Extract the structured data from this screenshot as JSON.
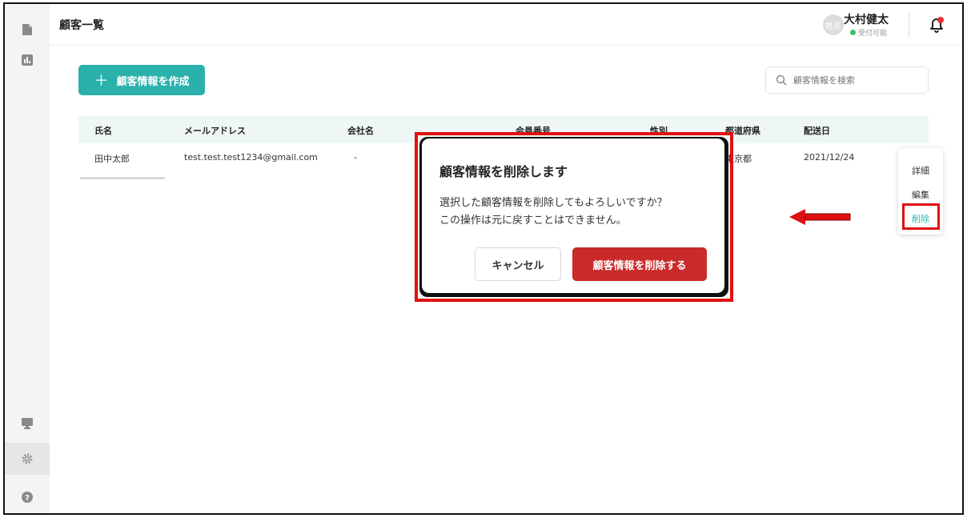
{
  "header": {
    "title": "顧客一覧",
    "avatar_text": "姓名",
    "user_name": "大村健太",
    "user_status": "受付可能"
  },
  "toolbar": {
    "create_label": "顧客情報を作成",
    "create_plus": "＋",
    "search_placeholder": "顧客情報を検索"
  },
  "table": {
    "columns": [
      "氏名",
      "メールアドレス",
      "会社名",
      "会員番号",
      "性別",
      "都道府県",
      "配送日"
    ],
    "rows": [
      [
        "田中太郎",
        "test.test.test1234@gmail.com",
        "-",
        "",
        "",
        "東京都",
        "2021/12/24"
      ]
    ]
  },
  "row_menu": {
    "items": [
      "詳細",
      "編集",
      "削除"
    ]
  },
  "dialog": {
    "title": "顧客情報を削除します",
    "line1": "選択した顧客情報を削除してもよろしいですか？",
    "line2": "この操作は元に戻すことはできません。",
    "cancel_label": "キャンセル",
    "confirm_label": "顧客情報を削除する"
  },
  "colors": {
    "accent": "#2ab1ac",
    "danger": "#c92a2a",
    "annotation": "#e01010"
  }
}
